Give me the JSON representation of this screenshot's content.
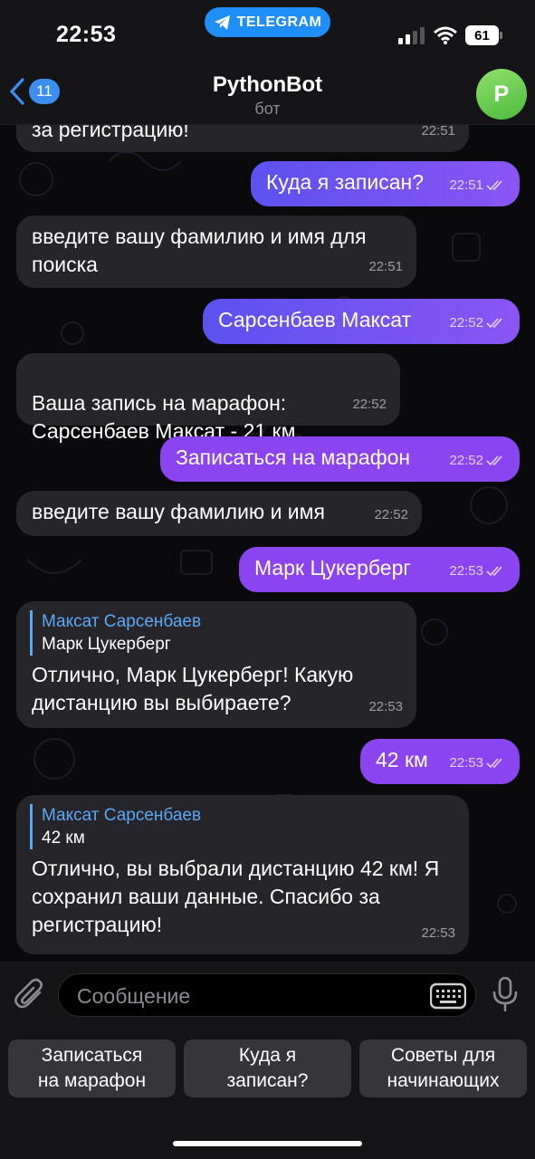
{
  "status_bar": {
    "time": "22:53",
    "app_pill": "TELEGRAM",
    "battery": "61"
  },
  "header": {
    "back_count": "11",
    "title": "PythonBot",
    "subtitle": "бот",
    "avatar_letter": "P",
    "avatar_color": "#5ec84a"
  },
  "messages": [
    {
      "dir": "in",
      "text": "за регистрацию!",
      "time": "22:51"
    },
    {
      "dir": "out",
      "text": "Куда я записан?",
      "time": "22:51"
    },
    {
      "dir": "in",
      "text": "введите вашу фамилию и имя для поиска",
      "time": "22:51"
    },
    {
      "dir": "out",
      "text": "Сарсенбаев Максат",
      "time": "22:52"
    },
    {
      "dir": "in",
      "text": "Ваша запись на марафон:\n Сарсенбаев Максат - 21 км",
      "time": "22:52"
    },
    {
      "dir": "out",
      "text": "Записаться на марафон",
      "time": "22:52"
    },
    {
      "dir": "in",
      "text": "введите вашу фамилию и имя",
      "time": "22:52"
    },
    {
      "dir": "out",
      "text": "Марк Цукерберг",
      "time": "22:53"
    },
    {
      "dir": "in",
      "reply_name": "Максат Сарсенбаев",
      "reply_text": "Марк Цукерберг",
      "text": "Отлично, Марк Цукерберг! Какую дистанцию вы выбираете?",
      "time": "22:53"
    },
    {
      "dir": "out",
      "text": "42 км",
      "time": "22:53"
    },
    {
      "dir": "in",
      "reply_name": "Максат Сарсенбаев",
      "reply_text": "42 км",
      "text": "Отлично, вы выбрали дистанцию 42 км! Я сохранил ваши данные. Спасибо за регистрацию!",
      "time": "22:53"
    }
  ],
  "input": {
    "placeholder": "Сообщение"
  },
  "keyboard_buttons": [
    {
      "label": "Записаться\nна марафон"
    },
    {
      "label": "Куда я\nзаписан?"
    },
    {
      "label": "Советы для\nначинающих"
    }
  ],
  "colors": {
    "accent": "#3c8ef0",
    "outgoing_start": "#5c52f0",
    "outgoing_end": "#8a45f0",
    "incoming": "#262529"
  }
}
